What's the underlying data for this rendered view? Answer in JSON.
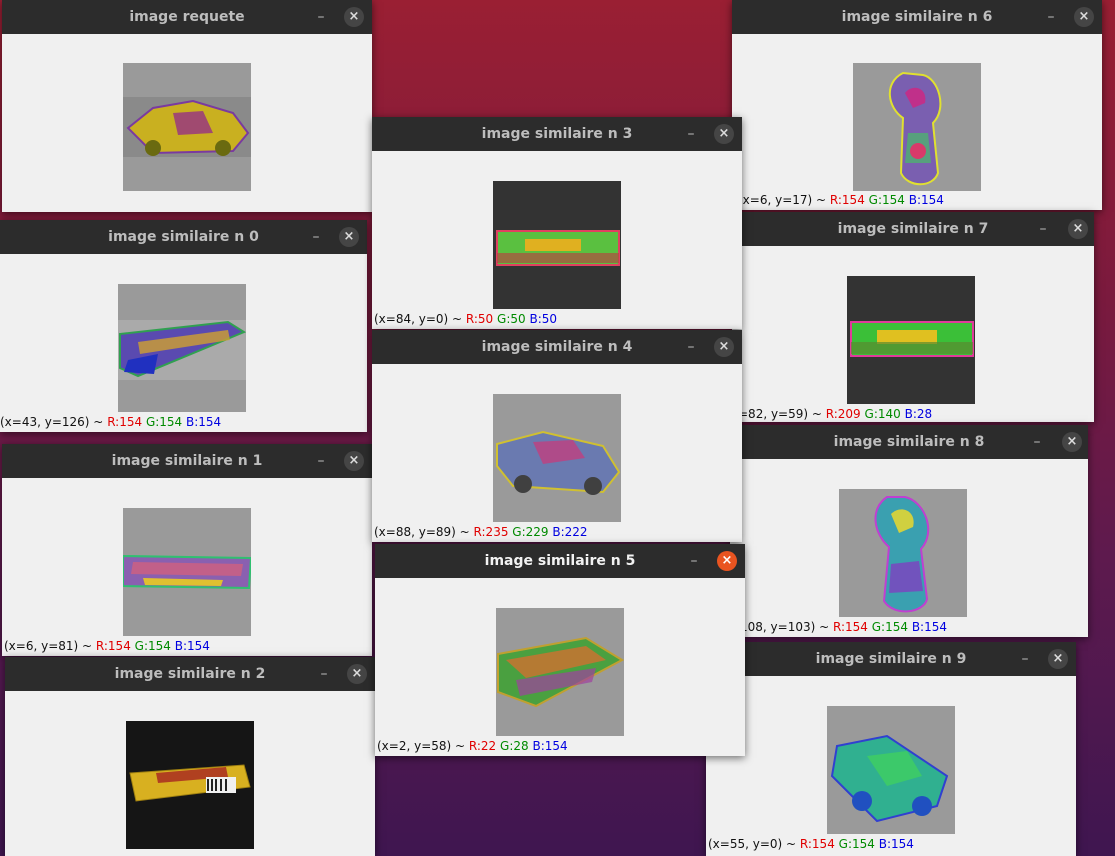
{
  "windows": {
    "w6": {
      "title": "image similaire n 6",
      "coords": "(x=6, y=17) ~",
      "r": "R:154",
      "g": "G:154",
      "b": "B:154"
    },
    "w7": {
      "title": "image similaire n 7",
      "coords": "=82, y=59) ~",
      "r": "R:209",
      "g": "G:140",
      "b": "B:28"
    },
    "w8": {
      "title": "image similaire n 8",
      "coords": "108, y=103) ~",
      "r": "R:154",
      "g": "G:154",
      "b": "B:154"
    },
    "w9": {
      "title": "image similaire n 9",
      "coords": "(x=55, y=0) ~",
      "r": "R:154",
      "g": "G:154",
      "b": "B:154"
    },
    "wq": {
      "title": "image requete"
    },
    "w0": {
      "title": "image similaire n 0",
      "coords": "(x=43, y=126) ~",
      "r": "R:154",
      "g": "G:154",
      "b": "B:154"
    },
    "w1": {
      "title": "image similaire n 1",
      "coords": "(x=6, y=81) ~",
      "r": "R:154",
      "g": "G:154",
      "b": "B:154"
    },
    "w2": {
      "title": "image similaire n 2"
    },
    "w3": {
      "title": "image similaire n 3",
      "coords": "(x=84, y=0) ~",
      "r": "R:50",
      "g": "G:50",
      "b": "B:50"
    },
    "w4": {
      "title": "image similaire n 4",
      "coords": "(x=88, y=89) ~",
      "r": "R:235",
      "g": "G:229",
      "b": "B:222"
    },
    "w5": {
      "title": "image similaire n 5",
      "coords": "(x=2, y=58) ~",
      "r": "R:22",
      "g": "G:28",
      "b": "B:154"
    }
  },
  "controls": {
    "minimize": "–",
    "close": "×"
  },
  "icons": {
    "minimize": "minimize-icon",
    "close": "close-icon"
  },
  "colors": {
    "accent_close": "#e95420",
    "titlebar": "#2c2c2c"
  }
}
